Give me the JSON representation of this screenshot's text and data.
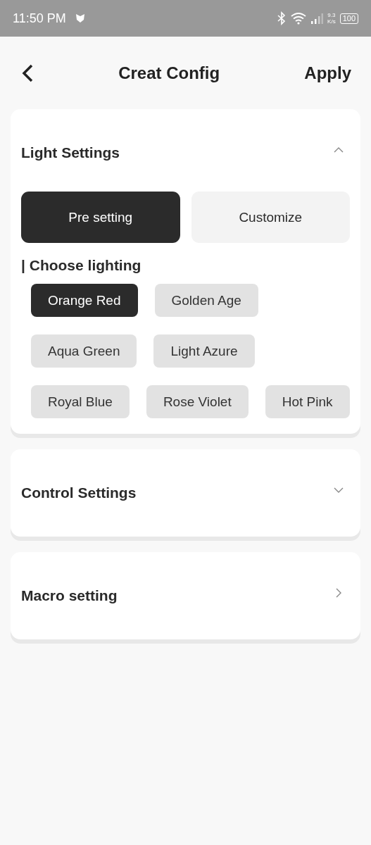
{
  "status_bar": {
    "time": "11:50 PM",
    "speed_value": "9.3",
    "speed_unit": "K/s",
    "battery": "100"
  },
  "header": {
    "title": "Creat Config",
    "action": "Apply"
  },
  "sections": [
    {
      "kind": "expandable",
      "title": "Light Settings",
      "expanded": true,
      "modes": [
        {
          "label": "Pre setting",
          "selected": true
        },
        {
          "label": "Customize",
          "selected": false
        }
      ],
      "subheading": "| Choose lighting",
      "options": [
        {
          "label": "Orange Red",
          "selected": true
        },
        {
          "label": "Golden Age",
          "selected": false
        },
        {
          "label": "Aqua Green",
          "selected": false
        },
        {
          "label": "Light Azure",
          "selected": false
        },
        {
          "label": "Royal Blue",
          "selected": false
        },
        {
          "label": "Rose Violet",
          "selected": false
        },
        {
          "label": "Hot Pink",
          "selected": false
        }
      ]
    },
    {
      "kind": "expandable",
      "title": "Control Settings",
      "expanded": false
    },
    {
      "kind": "link",
      "title": "Macro setting"
    }
  ]
}
